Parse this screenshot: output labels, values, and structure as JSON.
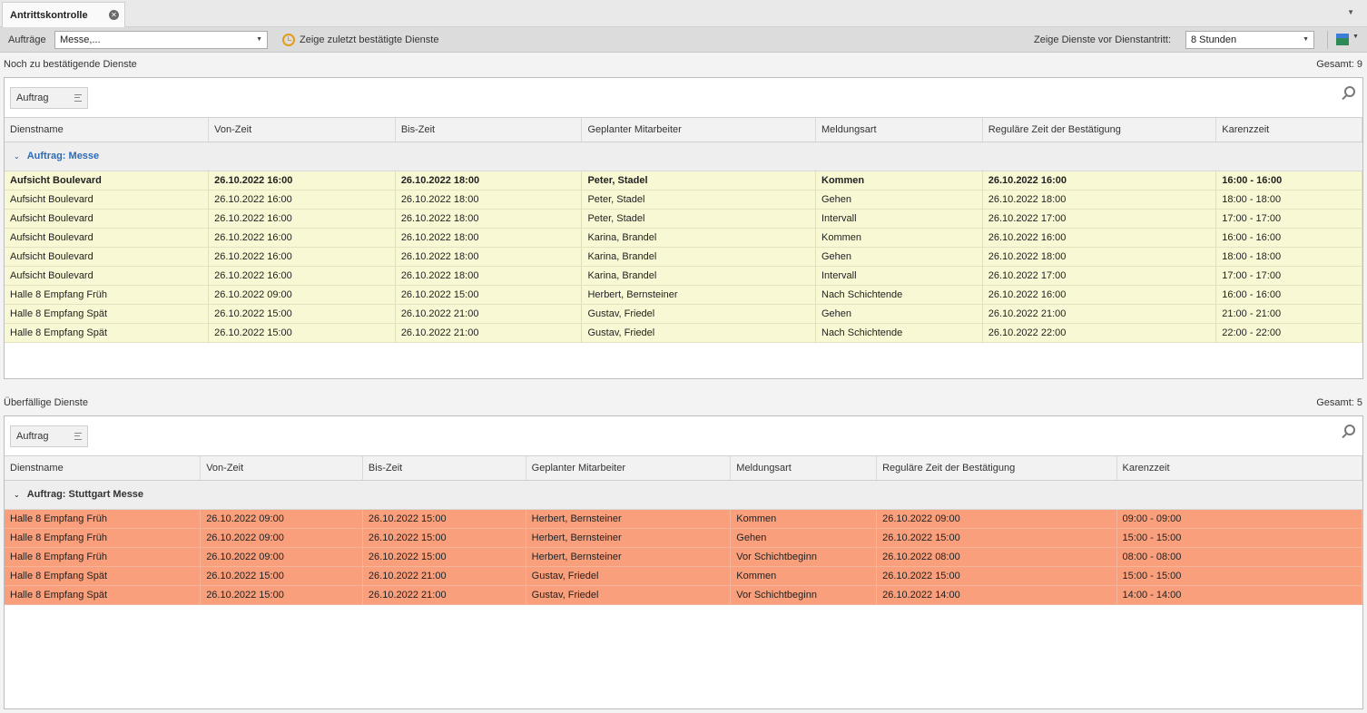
{
  "tab": {
    "title": "Antrittskontrolle"
  },
  "toolbar": {
    "orders_label": "Aufträge",
    "orders_value": "Messe,...",
    "show_confirmed_label": "Zeige zuletzt bestätigte Dienste",
    "show_before_label": "Zeige Dienste vor Dienstantritt:",
    "show_before_value": "8 Stunden"
  },
  "pending": {
    "title": "Noch zu bestätigende Dienste",
    "total": "Gesamt: 9",
    "group_chip": "Auftrag",
    "columns": [
      "Dienstname",
      "Von-Zeit",
      "Bis-Zeit",
      "Geplanter Mitarbeiter",
      "Meldungsart",
      "Reguläre Zeit der Bestätigung",
      "Karenzzeit"
    ],
    "group_label": "Auftrag: Messe",
    "rows": [
      [
        "Aufsicht Boulevard",
        "26.10.2022 16:00",
        "26.10.2022 18:00",
        "Peter, Stadel",
        "Kommen",
        "26.10.2022 16:00",
        "16:00 - 16:00"
      ],
      [
        "Aufsicht Boulevard",
        "26.10.2022 16:00",
        "26.10.2022 18:00",
        "Peter, Stadel",
        "Gehen",
        "26.10.2022 18:00",
        "18:00 - 18:00"
      ],
      [
        "Aufsicht Boulevard",
        "26.10.2022 16:00",
        "26.10.2022 18:00",
        "Peter, Stadel",
        "Intervall",
        "26.10.2022 17:00",
        "17:00 - 17:00"
      ],
      [
        "Aufsicht Boulevard",
        "26.10.2022 16:00",
        "26.10.2022 18:00",
        "Karina, Brandel",
        "Kommen",
        "26.10.2022 16:00",
        "16:00 - 16:00"
      ],
      [
        "Aufsicht Boulevard",
        "26.10.2022 16:00",
        "26.10.2022 18:00",
        "Karina, Brandel",
        "Gehen",
        "26.10.2022 18:00",
        "18:00 - 18:00"
      ],
      [
        "Aufsicht Boulevard",
        "26.10.2022 16:00",
        "26.10.2022 18:00",
        "Karina, Brandel",
        "Intervall",
        "26.10.2022 17:00",
        "17:00 - 17:00"
      ],
      [
        "Halle 8 Empfang Früh",
        "26.10.2022 09:00",
        "26.10.2022 15:00",
        "Herbert, Bernsteiner",
        "Nach Schichtende",
        "26.10.2022 16:00",
        "16:00 - 16:00"
      ],
      [
        "Halle 8 Empfang Spät",
        "26.10.2022 15:00",
        "26.10.2022 21:00",
        "Gustav, Friedel",
        "Gehen",
        "26.10.2022 21:00",
        "21:00 - 21:00"
      ],
      [
        "Halle 8 Empfang Spät",
        "26.10.2022 15:00",
        "26.10.2022 21:00",
        "Gustav, Friedel",
        "Nach Schichtende",
        "26.10.2022 22:00",
        "22:00 - 22:00"
      ]
    ]
  },
  "overdue": {
    "title": "Überfällige Dienste",
    "total": "Gesamt: 5",
    "group_chip": "Auftrag",
    "columns": [
      "Dienstname",
      "Von-Zeit",
      "Bis-Zeit",
      "Geplanter Mitarbeiter",
      "Meldungsart",
      "Reguläre Zeit der Bestätigung",
      "Karenzzeit"
    ],
    "group_label": "Auftrag: Stuttgart Messe",
    "rows": [
      [
        "Halle 8 Empfang Früh",
        "26.10.2022 09:00",
        "26.10.2022 15:00",
        "Herbert, Bernsteiner",
        "Kommen",
        "26.10.2022 09:00",
        "09:00 - 09:00"
      ],
      [
        "Halle 8 Empfang Früh",
        "26.10.2022 09:00",
        "26.10.2022 15:00",
        "Herbert, Bernsteiner",
        "Gehen",
        "26.10.2022 15:00",
        "15:00 - 15:00"
      ],
      [
        "Halle 8 Empfang Früh",
        "26.10.2022 09:00",
        "26.10.2022 15:00",
        "Herbert, Bernsteiner",
        "Vor Schichtbeginn",
        "26.10.2022 08:00",
        "08:00 - 08:00"
      ],
      [
        "Halle 8 Empfang Spät",
        "26.10.2022 15:00",
        "26.10.2022 21:00",
        "Gustav, Friedel",
        "Kommen",
        "26.10.2022 15:00",
        "15:00 - 15:00"
      ],
      [
        "Halle 8 Empfang Spät",
        "26.10.2022 15:00",
        "26.10.2022 21:00",
        "Gustav, Friedel",
        "Vor Schichtbeginn",
        "26.10.2022 14:00",
        "14:00 - 14:00"
      ]
    ]
  },
  "colors": {
    "pending_row": "#f9f8d4",
    "overdue_row": "#f99f7c",
    "group_accent": "#2b6cb8",
    "clock": "#e39b1c"
  }
}
